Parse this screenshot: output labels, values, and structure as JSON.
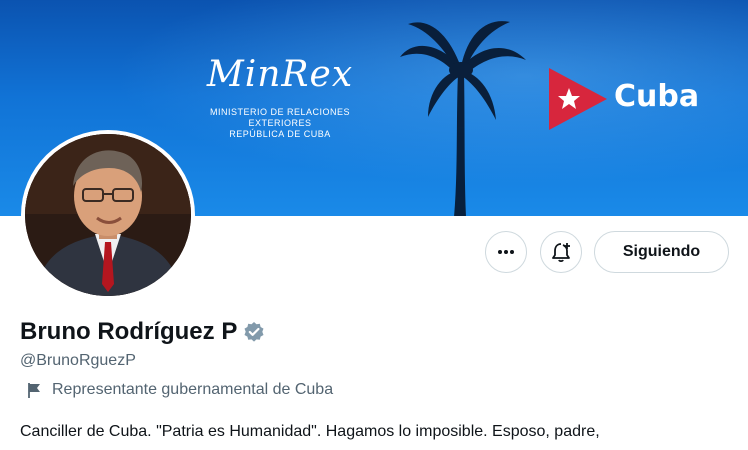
{
  "banner": {
    "org_logo_text": "MinRex",
    "org_line1": "MINISTERIO DE RELACIONES EXTERIORES",
    "org_line2": "REPÚBLICA DE CUBA",
    "country_text": "Cuba",
    "colors": {
      "blue_top": "#0b53b0",
      "blue_bottom": "#1a8ae8",
      "flag_red": "#d7263d"
    }
  },
  "profile": {
    "display_name": "Bruno Rodríguez P",
    "handle": "@BrunoRguezP",
    "label": "Representante gubernamental de Cuba",
    "bio": "Canciller de Cuba. \"Patria es Humanidad\". Hagamos lo imposible. Esposo, padre,",
    "verified_icon": "verified-badge-icon",
    "label_icon": "flag-icon"
  },
  "actions": {
    "more_icon": "more-dots-icon",
    "notify_icon": "bell-plus-icon",
    "follow_label": "Siguiendo"
  }
}
